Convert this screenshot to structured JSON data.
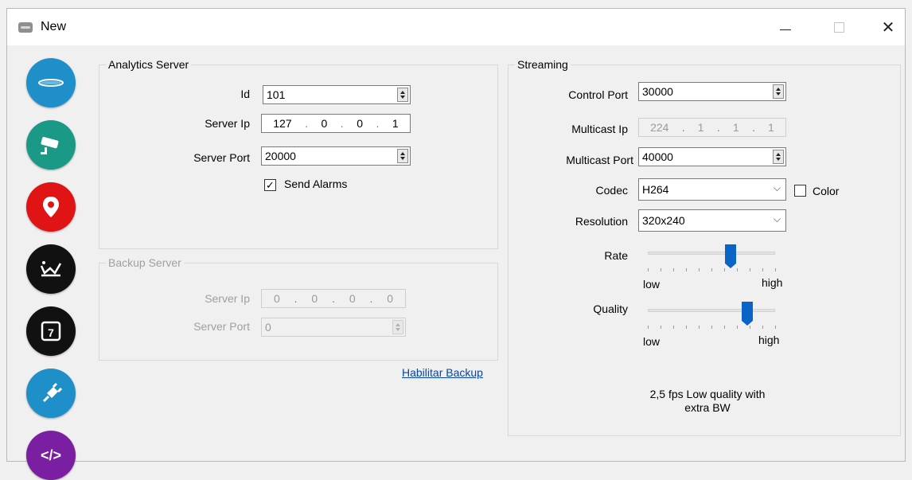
{
  "window": {
    "title": "New",
    "minimize_glyph": "—",
    "close_glyph": "✕"
  },
  "sidebar": {
    "icons": [
      {
        "name": "camera-lens-icon",
        "color": "#1f8fc9"
      },
      {
        "name": "cctv-camera-icon",
        "color": "#1a9a86"
      },
      {
        "name": "map-pin-icon",
        "color": "#e01414"
      },
      {
        "name": "zone-polygon-icon",
        "color": "#111111"
      },
      {
        "name": "calendar-icon",
        "color": "#111111",
        "text": "7"
      },
      {
        "name": "plug-icon",
        "color": "#1f8fc9"
      },
      {
        "name": "code-icon",
        "color": "#7b1fa2",
        "text": "</>"
      }
    ]
  },
  "analytics": {
    "legend": "Analytics Server",
    "id_label": "Id",
    "id_value": "101",
    "server_ip_label": "Server Ip",
    "server_ip": [
      "127",
      "0",
      "0",
      "1"
    ],
    "server_port_label": "Server Port",
    "server_port_value": "20000",
    "send_alarms_label": "Send Alarms",
    "send_alarms_checked": true,
    "check_glyph": "✓"
  },
  "backup": {
    "legend": "Backup Server",
    "server_ip_label": "Server Ip",
    "server_ip": [
      "0",
      "0",
      "0",
      "0"
    ],
    "server_port_label": "Server Port",
    "server_port_value": "0",
    "enable_link": "Habilitar Backup"
  },
  "streaming": {
    "legend": "Streaming",
    "control_port_label": "Control Port",
    "control_port_value": "30000",
    "multicast_ip_label": "Multicast Ip",
    "multicast_ip": [
      "224",
      "1",
      "1",
      "1"
    ],
    "multicast_port_label": "Multicast Port",
    "multicast_port_value": "40000",
    "codec_label": "Codec",
    "codec_value": "H264",
    "color_label": "Color",
    "color_checked": false,
    "resolution_label": "Resolution",
    "resolution_value": "320x240",
    "rate_label": "Rate",
    "rate_low": "low",
    "rate_high": "high",
    "rate_level": 0.65,
    "quality_label": "Quality",
    "quality_low": "low",
    "quality_high": "high",
    "quality_level": 0.78,
    "summary_line1": "2,5 fps Low quality with",
    "summary_line2": "extra BW",
    "chevron_glyph": "⌵"
  }
}
